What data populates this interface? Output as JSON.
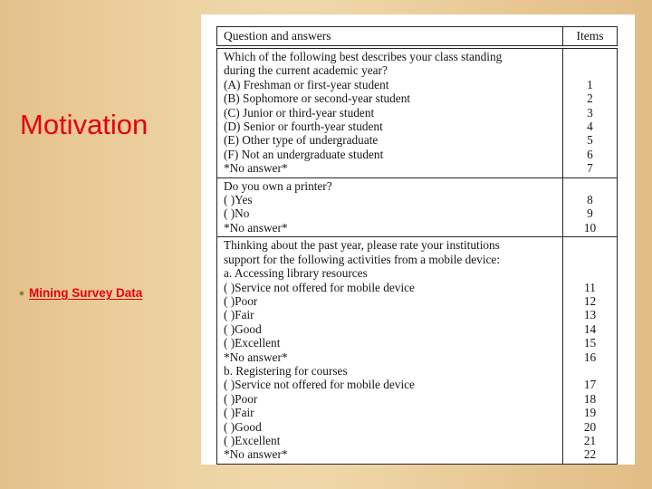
{
  "slide": {
    "title": "Motivation",
    "bullet_symbol": "●",
    "bullet_text": "Mining Survey Data",
    "title_color": "#e8000a",
    "bullet_color": "#8b8b20",
    "background_color": "#ecd0a0"
  },
  "table": {
    "header": {
      "question_column": "Question and answers",
      "items_column": "Items"
    },
    "blocks": [
      {
        "lines": [
          "Which of the following best describes your class standing",
          "during the current academic year?",
          "(A) Freshman or first-year student",
          "(B) Sophomore or second-year student",
          "(C) Junior or third-year student",
          "(D) Senior or fourth-year student",
          "(E) Other type of undergraduate",
          "(F) Not an undergraduate student",
          "*No answer*"
        ],
        "items": [
          "",
          "",
          "1",
          "2",
          "3",
          "4",
          "5",
          "6",
          "7"
        ]
      },
      {
        "lines": [
          "Do you own a printer?",
          "( )Yes",
          "( )No",
          "*No answer*"
        ],
        "items": [
          "",
          "8",
          "9",
          "10"
        ]
      },
      {
        "lines": [
          "Thinking about the past year, please rate your institutions",
          "support for the following activities from a mobile device:",
          "a. Accessing library resources",
          "( )Service not offered for mobile device",
          "( )Poor",
          "( )Fair",
          "( )Good",
          "( )Excellent",
          "*No answer*",
          "b. Registering for courses",
          "( )Service not offered for mobile device",
          "( )Poor",
          "( )Fair",
          "( )Good",
          "( )Excellent",
          "*No answer*"
        ],
        "items": [
          "",
          "",
          "",
          "11",
          "12",
          "13",
          "14",
          "15",
          "16",
          "",
          "17",
          "18",
          "19",
          "20",
          "21",
          "22"
        ]
      }
    ]
  }
}
